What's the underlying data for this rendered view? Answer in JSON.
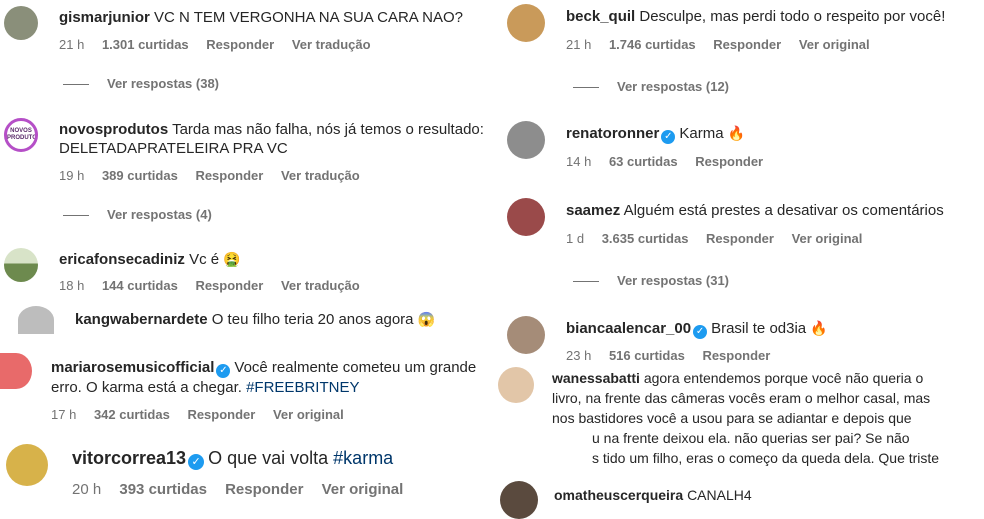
{
  "left": [
    {
      "user": "gismarjunior",
      "verified": false,
      "text": "VC N TEM VERGONHA NA SUA CARA NAO?",
      "time": "21 h",
      "likes": "1.301 curtidas",
      "reply": "Responder",
      "translate": "Ver tradução",
      "replies": "Ver respostas (38)",
      "avatar_color": "#8a8f7a"
    },
    {
      "user": "novosprodutos",
      "verified": false,
      "text": "Tarda mas não falha, nós já temos o resultado:",
      "text2": "DELETADAPRATELEIRA PRA VC",
      "time": "19 h",
      "likes": "389 curtidas",
      "reply": "Responder",
      "translate": "Ver tradução",
      "replies": "Ver respostas (4)",
      "avatar_color": "#b54fc7",
      "avatar_text": "NOVOS\nPRODUTOS"
    },
    {
      "user": "ericafonsecadiniz",
      "verified": false,
      "text": "Vc é",
      "emoji": "🤮",
      "time": "18 h",
      "likes": "144 curtidas",
      "reply": "Responder",
      "translate": "Ver tradução",
      "avatar_color": "#6d8a4e"
    },
    {
      "user": "kangwabernardete",
      "verified": false,
      "text": "O teu filho teria 20 anos agora",
      "emoji": "😱",
      "avatar_color": "#b5b5b5"
    },
    {
      "user": "mariarosemusicofficial",
      "verified": true,
      "text": "Você realmente cometeu um grande",
      "text2a": "erro. O karma está a chegar.",
      "tag": "#FREEBRITNEY",
      "time": "17 h",
      "likes": "342 curtidas",
      "reply": "Responder",
      "translate": "Ver original",
      "avatar_color": "#e86a6a"
    },
    {
      "user": "vitorcorrea13",
      "verified": true,
      "text": "O que vai volta",
      "tag": "#karma",
      "time": "20 h",
      "likes": "393 curtidas",
      "reply": "Responder",
      "translate": "Ver original",
      "avatar_color": "#d7b24a"
    }
  ],
  "right": [
    {
      "user": "beck_quil",
      "verified": false,
      "text": "Desculpe, mas perdi todo o respeito por você!",
      "time": "21 h",
      "likes": "1.746 curtidas",
      "reply": "Responder",
      "translate": "Ver original",
      "replies": "Ver respostas (12)",
      "avatar_color": "#c99a5a"
    },
    {
      "user": "renatoronner",
      "verified": true,
      "text": "Karma",
      "emoji": "🔥",
      "time": "14 h",
      "likes": "63 curtidas",
      "reply": "Responder",
      "avatar_color": "#8d8d8d"
    },
    {
      "user": "saamez",
      "verified": false,
      "text": "Alguém está prestes a desativar os comentários",
      "time": "1 d",
      "likes": "3.635 curtidas",
      "reply": "Responder",
      "translate": "Ver original",
      "replies": "Ver respostas (31)",
      "avatar_color": "#9a4a4a"
    },
    {
      "user": "biancaalencar_00",
      "verified": true,
      "text": "Brasil te od3ia",
      "emoji": "🔥",
      "time": "23 h",
      "likes": "516 curtidas",
      "reply": "Responder",
      "avatar_color": "#a58c78"
    },
    {
      "user": "wanessabatti",
      "verified": false,
      "lines": [
        "agora entendemos porque você não queria o",
        "livro, na frente das câmeras vocês eram o melhor casal, mas",
        "nos bastidores você a usou para se adiantar e depois que",
        "u na frente deixou ela. não querias ser pai? Se não",
        "s tido um filho, eras o começo da queda dela. Que triste"
      ],
      "avatar_color": "#e2c6a8"
    },
    {
      "user": "omatheuscerqueira",
      "verified": false,
      "text": "CANALH4",
      "avatar_color": "#5a4a3e"
    }
  ]
}
